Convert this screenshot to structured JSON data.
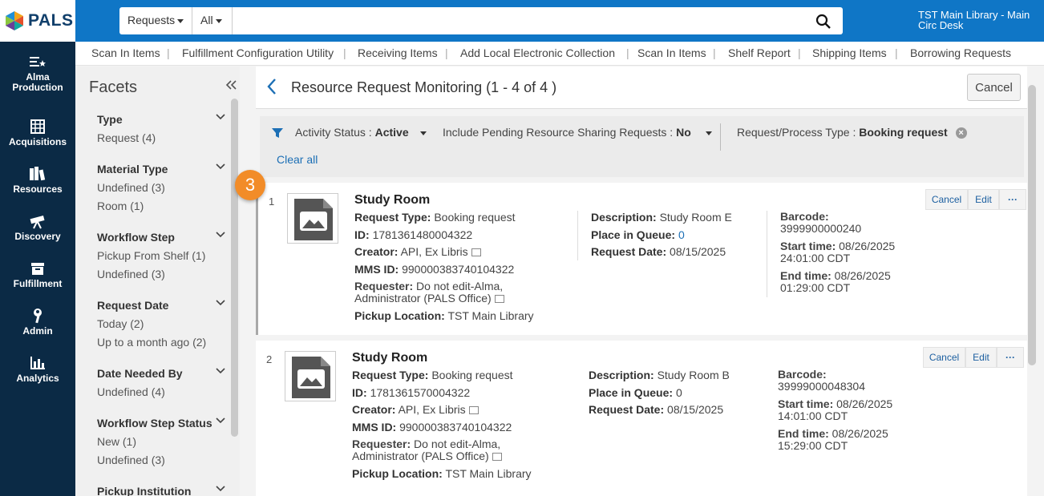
{
  "header": {
    "logo_text": "PALS",
    "search_scope": "Requests",
    "search_filter": "All",
    "search_placeholder": "",
    "desk_line1": "TST Main Library - Main",
    "desk_line2": "Circ Desk"
  },
  "nav": [
    {
      "label1": "Alma",
      "label2": "Production",
      "icon": "menu-star-icon"
    },
    {
      "label1": "Acquisitions",
      "label2": "",
      "icon": "ledger-icon"
    },
    {
      "label1": "Resources",
      "label2": "",
      "icon": "books-icon"
    },
    {
      "label1": "Discovery",
      "label2": "",
      "icon": "telescope-icon"
    },
    {
      "label1": "Fulfillment",
      "label2": "",
      "icon": "box-icon"
    },
    {
      "label1": "Admin",
      "label2": "",
      "icon": "wrench-icon"
    },
    {
      "label1": "Analytics",
      "label2": "",
      "icon": "bar-chart-icon"
    }
  ],
  "shortcuts": [
    "Scan In Items",
    "Fulfillment Configuration Utility",
    "Receiving Items",
    "Add Local Electronic Collection",
    "Scan In Items",
    "Shelf Report",
    "Shipping Items",
    "Borrowing Requests"
  ],
  "facets": {
    "title": "Facets",
    "groups": [
      {
        "name": "Type",
        "values": [
          "Request (4)"
        ]
      },
      {
        "name": "Material Type",
        "values": [
          "Undefined (3)",
          "Room (1)"
        ]
      },
      {
        "name": "Workflow Step",
        "values": [
          "Pickup From Shelf (1)",
          "Undefined (3)"
        ]
      },
      {
        "name": "Request Date",
        "values": [
          "Today (2)",
          "Up to a month ago (2)"
        ]
      },
      {
        "name": "Date Needed By",
        "values": [
          "Undefined (4)"
        ]
      },
      {
        "name": "Workflow Step Status",
        "values": [
          "New (1)",
          "Undefined (3)"
        ]
      },
      {
        "name": "Pickup Institution",
        "values": []
      }
    ]
  },
  "page": {
    "title": "Resource Request Monitoring (1 - 4 of 4 )",
    "cancel_label": "Cancel"
  },
  "filters": {
    "activity_label": "Activity Status :",
    "activity_value": "Active",
    "pending_label": "Include Pending Resource Sharing Requests :",
    "pending_value": "No",
    "type_label": "Request/Process Type :",
    "type_value": "Booking request",
    "clear_all": "Clear all"
  },
  "step_badge": "3",
  "labels": {
    "request_type": "Request Type:",
    "id": "ID:",
    "creator": "Creator:",
    "mms_id": "MMS ID:",
    "requester": "Requester:",
    "pickup": "Pickup Location:",
    "description": "Description:",
    "queue": "Place in Queue:",
    "request_date": "Request Date:",
    "barcode": "Barcode:",
    "start": "Start time:",
    "end": "End time:",
    "cancel": "Cancel",
    "edit": "Edit",
    "more": "···"
  },
  "requests": [
    {
      "num": "1",
      "title": "Study Room",
      "request_type": "Booking request",
      "id": "1781361480004322",
      "creator": "API, Ex Libris",
      "mms_id": "990000383740104322",
      "requester_line1": "Do not edit-Alma,",
      "requester_line2": "Administrator (PALS Office)",
      "pickup": "TST Main Library",
      "description": "Study Room E",
      "queue": "0",
      "request_date": "08/15/2025",
      "barcode": "3999900000240",
      "start_date": "08/26/2025",
      "start_time": "24:01:00 CDT",
      "end_date": "08/26/2025",
      "end_time": "01:29:00 CDT"
    },
    {
      "num": "2",
      "title": "Study Room",
      "request_type": "Booking request",
      "id": "1781361570004322",
      "creator": "API, Ex Libris",
      "mms_id": "990000383740104322",
      "requester_line1": "Do not edit-Alma,",
      "requester_line2": "Administrator (PALS Office)",
      "pickup": "TST Main Library",
      "description": "Study Room B",
      "queue": "0",
      "request_date": "08/15/2025",
      "barcode": "39999000048304",
      "start_date": "08/26/2025",
      "start_time": "14:01:00 CDT",
      "end_date": "08/26/2025",
      "end_time": "15:29:00 CDT"
    }
  ]
}
